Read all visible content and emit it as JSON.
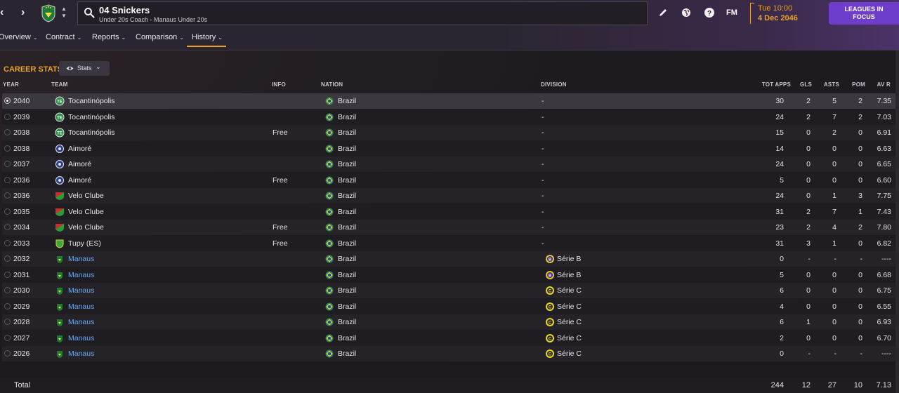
{
  "header": {
    "person_name": "04 Snickers",
    "person_role": "Under 20s Coach - Manaus Under 20s",
    "time": "Tue 10:00",
    "date": "4 Dec 2046",
    "fm_label": "FM",
    "leagues_button": "LEAGUES IN FOCUS"
  },
  "tabs": [
    {
      "label": "Overview"
    },
    {
      "label": "Contract"
    },
    {
      "label": "Reports"
    },
    {
      "label": "Comparison"
    },
    {
      "label": "History"
    }
  ],
  "active_tab": "History",
  "section": {
    "title": "CAREER STATS",
    "stats_button": "Stats"
  },
  "columns": {
    "year": "YEAR",
    "team": "TEAM",
    "info": "INFO",
    "nation": "NATION",
    "division": "DIVISION",
    "apps": "TOT APPS",
    "gls": "GLS",
    "asts": "ASTS",
    "pom": "POM",
    "avr": "AV R"
  },
  "rows": [
    {
      "year": "2040",
      "team": "Tocantinópolis",
      "info": "",
      "nation": "Brazil",
      "division": "-",
      "apps": "30",
      "gls": "2",
      "asts": "5",
      "pom": "2",
      "avr": "7.35",
      "logo": "tocantinopolis",
      "div_logo": ""
    },
    {
      "year": "2039",
      "team": "Tocantinópolis",
      "info": "",
      "nation": "Brazil",
      "division": "-",
      "apps": "24",
      "gls": "2",
      "asts": "7",
      "pom": "2",
      "avr": "7.03",
      "logo": "tocantinopolis",
      "div_logo": ""
    },
    {
      "year": "2038",
      "team": "Tocantinópolis",
      "info": "Free",
      "nation": "Brazil",
      "division": "-",
      "apps": "15",
      "gls": "0",
      "asts": "2",
      "pom": "0",
      "avr": "6.91",
      "logo": "tocantinopolis",
      "div_logo": ""
    },
    {
      "year": "2038",
      "team": "Aimoré",
      "info": "",
      "nation": "Brazil",
      "division": "-",
      "apps": "14",
      "gls": "0",
      "asts": "0",
      "pom": "0",
      "avr": "6.63",
      "logo": "aimore",
      "div_logo": ""
    },
    {
      "year": "2037",
      "team": "Aimoré",
      "info": "",
      "nation": "Brazil",
      "division": "-",
      "apps": "24",
      "gls": "0",
      "asts": "0",
      "pom": "0",
      "avr": "6.65",
      "logo": "aimore",
      "div_logo": ""
    },
    {
      "year": "2036",
      "team": "Aimoré",
      "info": "Free",
      "nation": "Brazil",
      "division": "-",
      "apps": "5",
      "gls": "0",
      "asts": "0",
      "pom": "0",
      "avr": "6.60",
      "logo": "aimore",
      "div_logo": ""
    },
    {
      "year": "2036",
      "team": "Velo Clube",
      "info": "",
      "nation": "Brazil",
      "division": "-",
      "apps": "24",
      "gls": "0",
      "asts": "1",
      "pom": "3",
      "avr": "7.75",
      "logo": "velo",
      "div_logo": ""
    },
    {
      "year": "2035",
      "team": "Velo Clube",
      "info": "",
      "nation": "Brazil",
      "division": "-",
      "apps": "31",
      "gls": "2",
      "asts": "7",
      "pom": "1",
      "avr": "7.43",
      "logo": "velo",
      "div_logo": ""
    },
    {
      "year": "2034",
      "team": "Velo Clube",
      "info": "Free",
      "nation": "Brazil",
      "division": "-",
      "apps": "23",
      "gls": "2",
      "asts": "4",
      "pom": "2",
      "avr": "7.80",
      "logo": "velo",
      "div_logo": ""
    },
    {
      "year": "2033",
      "team": "Tupy (ES)",
      "info": "Free",
      "nation": "Brazil",
      "division": "-",
      "apps": "31",
      "gls": "3",
      "asts": "1",
      "pom": "0",
      "avr": "6.82",
      "logo": "tupy",
      "div_logo": ""
    },
    {
      "year": "2032",
      "team": "Manaus",
      "info": "",
      "nation": "Brazil",
      "division": "Série B",
      "apps": "0",
      "gls": "-",
      "asts": "-",
      "pom": "-",
      "avr": "----",
      "logo": "manaus",
      "div_logo": "serie-b"
    },
    {
      "year": "2031",
      "team": "Manaus",
      "info": "",
      "nation": "Brazil",
      "division": "Série B",
      "apps": "5",
      "gls": "0",
      "asts": "0",
      "pom": "0",
      "avr": "6.68",
      "logo": "manaus",
      "div_logo": "serie-b"
    },
    {
      "year": "2030",
      "team": "Manaus",
      "info": "",
      "nation": "Brazil",
      "division": "Série C",
      "apps": "6",
      "gls": "0",
      "asts": "0",
      "pom": "0",
      "avr": "6.75",
      "logo": "manaus",
      "div_logo": "serie-c"
    },
    {
      "year": "2029",
      "team": "Manaus",
      "info": "",
      "nation": "Brazil",
      "division": "Série C",
      "apps": "4",
      "gls": "0",
      "asts": "0",
      "pom": "0",
      "avr": "6.55",
      "logo": "manaus",
      "div_logo": "serie-c"
    },
    {
      "year": "2028",
      "team": "Manaus",
      "info": "",
      "nation": "Brazil",
      "division": "Série C",
      "apps": "6",
      "gls": "1",
      "asts": "0",
      "pom": "0",
      "avr": "6.93",
      "logo": "manaus",
      "div_logo": "serie-c"
    },
    {
      "year": "2027",
      "team": "Manaus",
      "info": "",
      "nation": "Brazil",
      "division": "Série C",
      "apps": "2",
      "gls": "0",
      "asts": "0",
      "pom": "0",
      "avr": "6.70",
      "logo": "manaus",
      "div_logo": "serie-c"
    },
    {
      "year": "2026",
      "team": "Manaus",
      "info": "",
      "nation": "Brazil",
      "division": "Série C",
      "apps": "0",
      "gls": "-",
      "asts": "-",
      "pom": "-",
      "avr": "----",
      "logo": "manaus",
      "div_logo": "serie-c"
    }
  ],
  "selected_row": 0,
  "total": {
    "label": "Total",
    "apps": "244",
    "gls": "12",
    "asts": "27",
    "pom": "10",
    "avr": "7.13"
  },
  "colors": {
    "accent": "#e8a228",
    "link": "#6fa8e8",
    "leagues_button": "#6f3dcc"
  }
}
